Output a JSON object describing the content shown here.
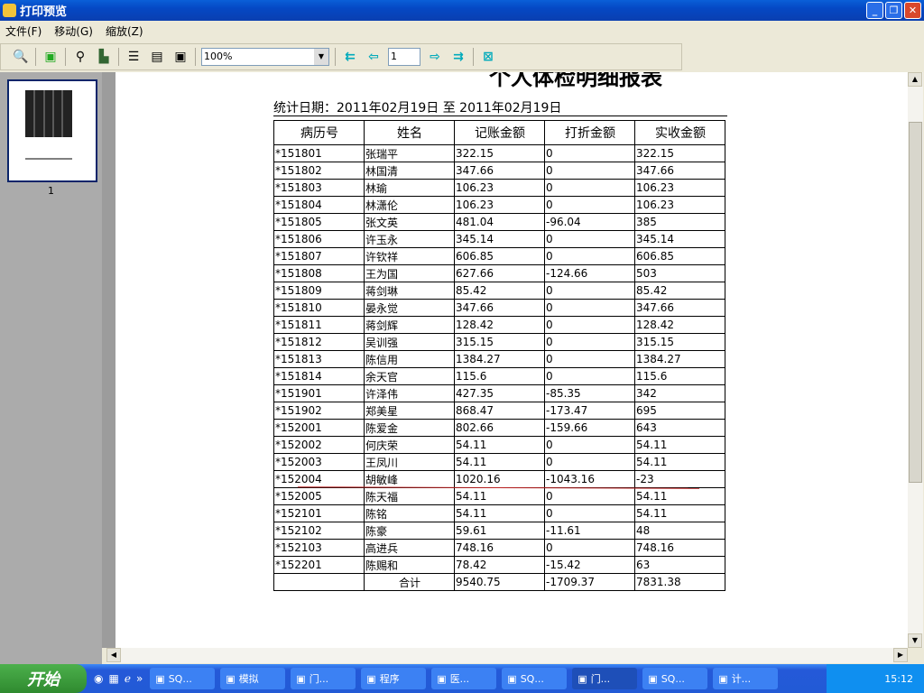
{
  "window": {
    "title": "打印预览",
    "minimize": "_",
    "maximize": "❐",
    "close": "✕"
  },
  "menu": [
    "文件(F)",
    "移动(G)",
    "缩放(Z)"
  ],
  "toolbar": {
    "zoom_value": "100%",
    "page_value": "1",
    "icons": [
      "magnifier-icon",
      "save-icon",
      "find-icon",
      "print-icon",
      "page-width-icon",
      "fit-page-icon",
      "whole-page-icon",
      "first-page-icon",
      "prev-page-icon",
      "next-page-icon",
      "last-page-icon",
      "close-preview-icon"
    ]
  },
  "thumbnails": {
    "page_label": "1"
  },
  "report": {
    "title": "个人体检明细报表",
    "date_line": "统计日期：2011年02月19日 至 2011年02月19日",
    "columns": [
      "病历号",
      "姓名",
      "记账金额",
      "打折金额",
      "实收金额"
    ],
    "rows": [
      [
        "*151801",
        "张瑞平",
        "322.15",
        "0",
        "322.15"
      ],
      [
        "*151802",
        "林国清",
        "347.66",
        "0",
        "347.66"
      ],
      [
        "*151803",
        "林瑜",
        "106.23",
        "0",
        "106.23"
      ],
      [
        "*151804",
        "林潇伦",
        "106.23",
        "0",
        "106.23"
      ],
      [
        "*151805",
        "张文英",
        "481.04",
        "-96.04",
        "385"
      ],
      [
        "*151806",
        "许玉永",
        "345.14",
        "0",
        "345.14"
      ],
      [
        "*151807",
        "许钦祥",
        "606.85",
        "0",
        "606.85"
      ],
      [
        "*151808",
        "王为国",
        "627.66",
        "-124.66",
        "503"
      ],
      [
        "*151809",
        "蒋剑琳",
        "85.42",
        "0",
        "85.42"
      ],
      [
        "*151810",
        "晏永觉",
        "347.66",
        "0",
        "347.66"
      ],
      [
        "*151811",
        "蒋剑辉",
        "128.42",
        "0",
        "128.42"
      ],
      [
        "*151812",
        "吴训强",
        "315.15",
        "0",
        "315.15"
      ],
      [
        "*151813",
        "陈信用",
        "1384.27",
        "0",
        "1384.27"
      ],
      [
        "*151814",
        "余天官",
        "115.6",
        "0",
        "115.6"
      ],
      [
        "*151901",
        "许泽伟",
        "427.35",
        "-85.35",
        "342"
      ],
      [
        "*151902",
        "郑美星",
        "868.47",
        "-173.47",
        "695"
      ],
      [
        "*152001",
        "陈爱金",
        "802.66",
        "-159.66",
        "643"
      ],
      [
        "*152002",
        "何庆荣",
        "54.11",
        "0",
        "54.11"
      ],
      [
        "*152003",
        "王凤川",
        "54.11",
        "0",
        "54.11"
      ],
      [
        "*152004",
        "胡敏峰",
        "1020.16",
        "-1043.16",
        "-23"
      ],
      [
        "*152005",
        "陈天福",
        "54.11",
        "0",
        "54.11"
      ],
      [
        "*152101",
        "陈铭",
        "54.11",
        "0",
        "54.11"
      ],
      [
        "*152102",
        "陈豪",
        "59.61",
        "-11.61",
        "48"
      ],
      [
        "*152103",
        "高进兵",
        "748.16",
        "0",
        "748.16"
      ],
      [
        "*152201",
        "陈赐和",
        "78.42",
        "-15.42",
        "63"
      ]
    ],
    "total": [
      "",
      "合计",
      "9540.75",
      "-1709.37",
      "7831.38"
    ]
  },
  "taskbar": {
    "start": "开始",
    "tasks": [
      "SQ...",
      "模拟",
      "门...",
      "程序",
      "医...",
      "SQ...",
      "门...",
      "SQ...",
      "计..."
    ],
    "active_index": 6,
    "clock": "15:12"
  }
}
